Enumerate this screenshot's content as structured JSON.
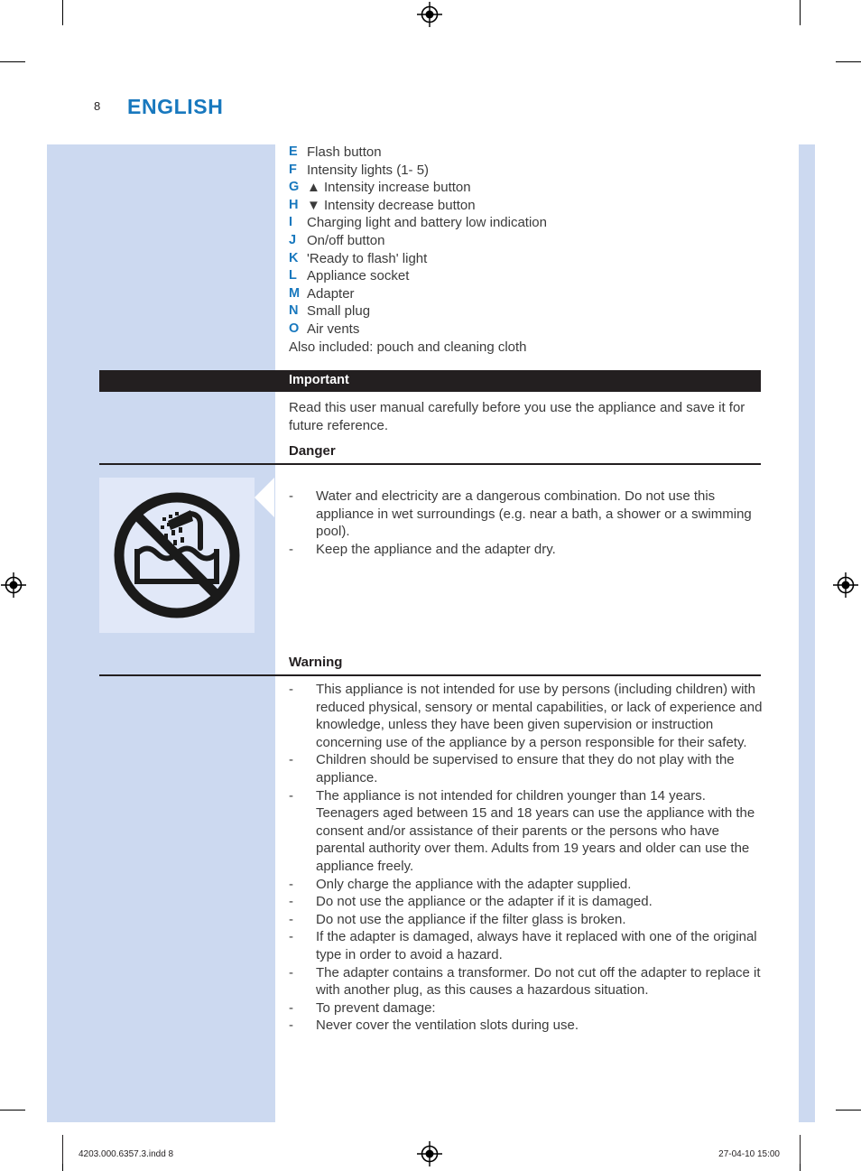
{
  "header": {
    "page_number": "8",
    "language_title": "ENGLISH",
    "accent_color": "#1878be"
  },
  "legend": {
    "items": [
      {
        "key": "E",
        "label": "Flash button"
      },
      {
        "key": "F",
        "label": "Intensity lights (1- 5)"
      },
      {
        "key": "G",
        "label": "▲ Intensity increase button"
      },
      {
        "key": "H",
        "label": "▼ Intensity decrease button"
      },
      {
        "key": "I",
        "label": "Charging light and battery low indication"
      },
      {
        "key": "J",
        "label": "On/off button"
      },
      {
        "key": "K",
        "label": "'Ready to flash' light"
      },
      {
        "key": "L",
        "label": "Appliance socket"
      },
      {
        "key": "M",
        "label": "Adapter"
      },
      {
        "key": "N",
        "label": "Small plug"
      },
      {
        "key": "O",
        "label": "Air vents"
      }
    ],
    "footnote": "Also included: pouch and cleaning cloth"
  },
  "important": {
    "bar_label": "Important",
    "bar_background": "#231f20",
    "intro": "Read this user manual carefully before you use the appliance and save it for future reference."
  },
  "danger": {
    "heading": "Danger",
    "pictogram": "no-water-shower-icon",
    "bullets": [
      "Water and electricity are a dangerous combination. Do not use this appliance in wet surroundings (e.g. near a bath, a shower or a swimming pool).",
      "Keep the appliance and the adapter dry."
    ]
  },
  "warning": {
    "heading": "Warning",
    "bullets": [
      "This appliance is not intended for use by persons (including children) with reduced physical, sensory or mental capabilities, or lack of experience and knowledge, unless they have been given supervision or instruction concerning use of the appliance by a person responsible for their safety.",
      "Children should be supervised to ensure that they do not play with the appliance.",
      "The appliance is not intended for children younger than 14 years. Teenagers aged between 15 and 18 years can use the appliance with the consent and/or assistance of their parents or the persons who have parental authority over them. Adults from 19 years and older can use the appliance freely.",
      "Only charge the appliance with the adapter supplied.",
      "Do not use the appliance or the adapter if it is damaged.",
      "Do not use the appliance if the filter glass is broken.",
      "If the adapter is damaged, always have it replaced with one of the original type in order to avoid a hazard.",
      "The adapter contains a transformer. Do not cut off the adapter to replace it with another plug, as this causes a hazardous situation.",
      "To prevent damage:",
      "Never cover the ventilation slots during use."
    ],
    "bullet_marker": "-"
  },
  "footer": {
    "file_name": "4203.000.6357.3.indd   8",
    "print_stamp": "27-04-10   15:00"
  },
  "theme": {
    "panel_blue": "#ccd9f0",
    "pictogram_blue": "#e1e8f8",
    "body_text": "#3b3b3b",
    "ink": "#231f20"
  }
}
